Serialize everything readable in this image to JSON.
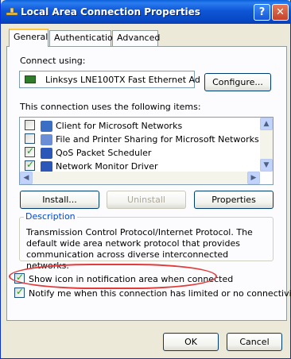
{
  "window": {
    "title": "Local Area Connection Properties",
    "help_button": "?",
    "close_button": "✕"
  },
  "tabs": [
    {
      "label": "General",
      "active": true
    },
    {
      "label": "Authentication",
      "active": false
    },
    {
      "label": "Advanced",
      "active": false
    }
  ],
  "connect_using": {
    "label": "Connect using:",
    "adapter_name": "Linksys LNE100TX Fast Ethernet Ad",
    "configure_button": "Configure..."
  },
  "items": {
    "label": "This connection uses the following items:",
    "list": [
      {
        "checked": false,
        "name": "Client for Microsoft Networks",
        "icon": "network-client-icon",
        "color": "#3a6fc4"
      },
      {
        "checked": false,
        "name": "File and Printer Sharing for Microsoft Networks",
        "icon": "printer-icon",
        "color": "#6b8fd6"
      },
      {
        "checked": true,
        "name": "QoS Packet Scheduler",
        "icon": "scheduler-icon",
        "color": "#2b58b8"
      },
      {
        "checked": true,
        "name": "Network Monitor Driver",
        "icon": "network-monitor-icon",
        "color": "#2b58b8"
      }
    ]
  },
  "buttons": {
    "install": "Install...",
    "uninstall": "Uninstall",
    "properties": "Properties",
    "ok": "OK",
    "cancel": "Cancel"
  },
  "description": {
    "title": "Description",
    "text": "Transmission Control Protocol/Internet Protocol. The default wide area network protocol that provides communication across diverse interconnected networks."
  },
  "options": {
    "show_icon": {
      "label": "Show icon in notification area when connected",
      "checked": true
    },
    "notify": {
      "label": "Notify me when this connection has limited or no connectivity",
      "checked": true
    }
  }
}
